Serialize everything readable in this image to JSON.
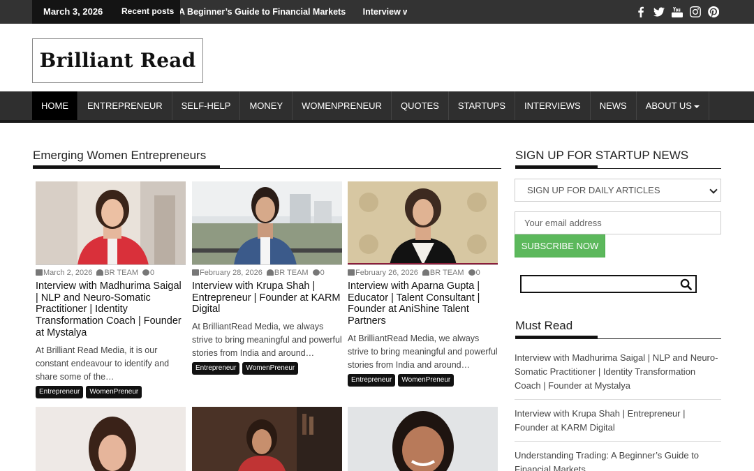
{
  "topbar": {
    "date": "March 3, 2026",
    "recent_label": "Recent posts",
    "ticker": [
      "A Beginner’s Guide to Financial Markets",
      "Interview with Aparna Gupta | Educator"
    ],
    "social": [
      "facebook-icon",
      "twitter-icon",
      "youtube-icon",
      "instagram-icon",
      "pinterest-icon"
    ]
  },
  "header": {
    "logo_text": "Brilliant Read"
  },
  "nav": {
    "items": [
      "HOME",
      "ENTREPRENEUR",
      "SELF-HELP",
      "MONEY",
      "WOMENPRENEUR",
      "QUOTES",
      "STARTUPS",
      "INTERVIEWS",
      "NEWS",
      "ABOUT US"
    ]
  },
  "main": {
    "section_title": "Emerging Women Entrepreneurs",
    "posts": [
      {
        "date": "March 2, 2026",
        "author": "BR TEAM",
        "comments": "0",
        "title": "Interview with Madhurima Saigal | NLP and Neuro-Somatic Practitioner | Identity Transformation Coach | Founder at Mystalya",
        "excerpt": "At Brilliant Read Media, it is our constant endeavour to identify and share some of the…",
        "tags": [
          "Entrepreneur",
          "WomenPreneur"
        ]
      },
      {
        "date": "February 28, 2026",
        "author": "BR TEAM",
        "comments": "0",
        "title": "Interview with Krupa Shah | Entrepreneur | Founder at KARM Digital",
        "excerpt": "At BrilliantRead Media, we always strive to bring meaningful and powerful stories from India and around…",
        "tags": [
          "Entrepreneur",
          "WomenPreneur"
        ]
      },
      {
        "date": "February 26, 2026",
        "author": "BR TEAM",
        "comments": "0",
        "title": "Interview with Aparna Gupta | Educator | Talent Consultant | Founder at AniShine Talent Partners",
        "excerpt": "At BrilliantRead Media, we always strive to bring meaningful and powerful stories from India and around…",
        "tags": [
          "Entrepreneur",
          "WomenPreneur"
        ]
      }
    ]
  },
  "sidebar": {
    "signup_title": "SIGN UP FOR STARTUP NEWS",
    "select_value": "SIGN UP FOR DAILY ARTICLES",
    "email_placeholder": "Your email address",
    "subscribe_label": "SUBSCRIBE NOW",
    "must_read_title": "Must Read",
    "must_read": [
      "Interview with Madhurima Saigal | NLP and Neuro-Somatic Practitioner | Identity Transformation Coach | Founder at Mystalya",
      "Interview with Krupa Shah | Entrepreneur | Founder at KARM Digital",
      "Understanding Trading: A Beginner’s Guide to Financial Markets"
    ]
  },
  "colors": {
    "topbar": "#333333",
    "nav": "#2f2f2f",
    "subscribe": "#5cb85c"
  }
}
